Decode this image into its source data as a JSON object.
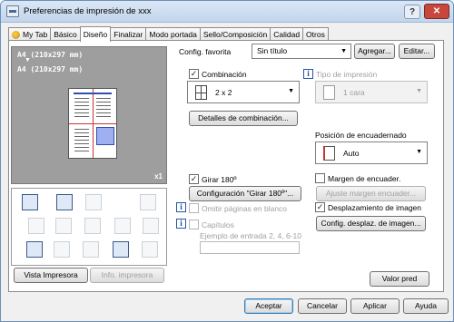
{
  "window": {
    "title": "Preferencias de impresión de xxx",
    "help_label": "?",
    "close_label": "✕"
  },
  "tabs": [
    {
      "label": "My Tab",
      "active": false
    },
    {
      "label": "Básico",
      "active": false
    },
    {
      "label": "Diseño",
      "active": true
    },
    {
      "label": "Finalizar",
      "active": false
    },
    {
      "label": "Modo portada",
      "active": false
    },
    {
      "label": "Sello/Composición",
      "active": false
    },
    {
      "label": "Calidad",
      "active": false
    },
    {
      "label": "Otros",
      "active": false
    }
  ],
  "preview": {
    "paper_top": "A4 (210x297 mm)",
    "arrow": "▼",
    "paper_bottom": "A4 (210x297 mm)",
    "copies": "x1"
  },
  "preview_buttons": {
    "printer_view": "Vista Impresora",
    "printer_info": "Info. impresora"
  },
  "favorites": {
    "label": "Config. favorita",
    "value": "Sin título",
    "add_button": "Agregar...",
    "edit_button": "Editar..."
  },
  "combination": {
    "label": "Combinación",
    "checked": true,
    "value": "2 x 2",
    "details_button": "Detalles de combinación..."
  },
  "print_type": {
    "label": "Tipo de impresión",
    "value": "1 cara",
    "disabled": true
  },
  "binding_position": {
    "label": "Posición de encuadernado",
    "value": "Auto"
  },
  "rotate": {
    "label": "Girar 180º",
    "checked": true,
    "config_button": "Configuración \"Girar 180º\"..."
  },
  "skip_blank": {
    "label": "Omitir páginas en blanco",
    "checked": false,
    "disabled": true
  },
  "chapters": {
    "label": "Capítulos",
    "checked": false,
    "disabled": true,
    "example": "Ejemplo de entrada 2, 4, 6-10"
  },
  "binding_margin": {
    "label": "Margen de encuader.",
    "checked": false,
    "adjust_button": "Ajuste margen encuader..."
  },
  "image_shift": {
    "label": "Desplazamiento de imagen",
    "checked": true,
    "config_button": "Config. desplaz. de imagen..."
  },
  "default_button": "Valor pred",
  "footer": {
    "ok": "Aceptar",
    "cancel": "Cancelar",
    "apply": "Aplicar",
    "help": "Ayuda"
  },
  "colors": {
    "accent_blue": "#2f4fb0",
    "accent_red": "#cc3333",
    "preview_gray": "#9e9e9e"
  }
}
